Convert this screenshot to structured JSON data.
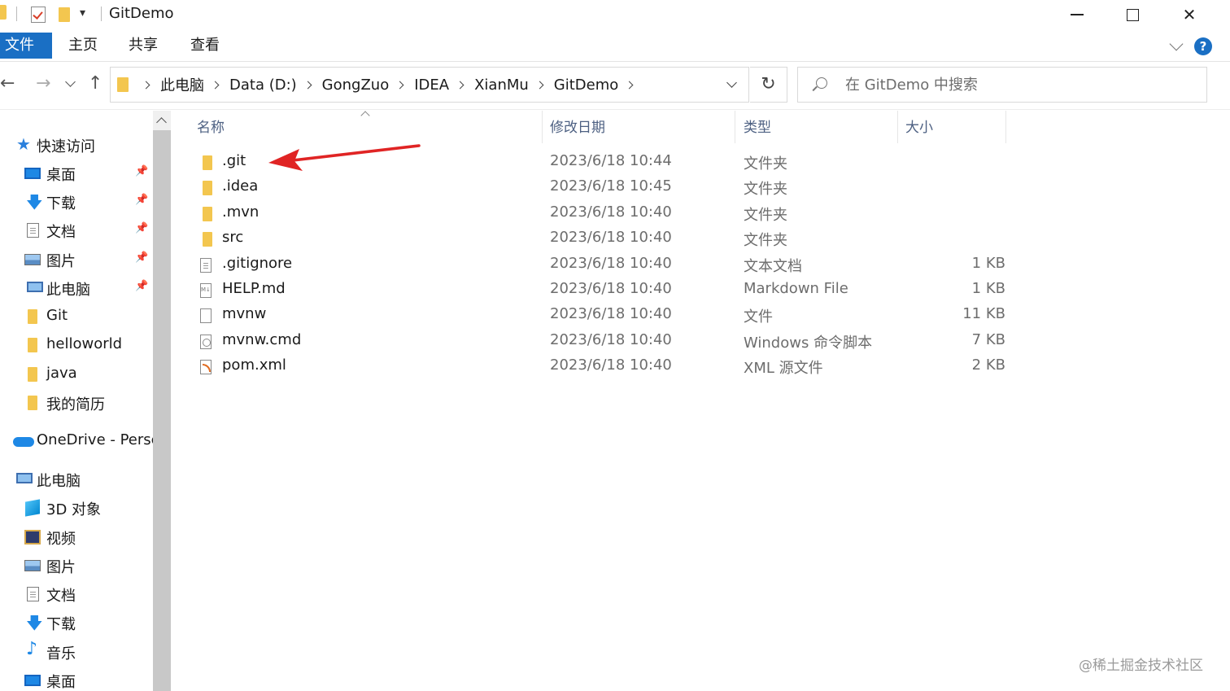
{
  "window": {
    "title": "GitDemo",
    "quick_access_dropdown": "▾",
    "controls": {
      "close_glyph": "✕"
    }
  },
  "ribbon": {
    "tabs": [
      "文件",
      "主页",
      "共享",
      "查看"
    ],
    "help_label": "?"
  },
  "nav": {
    "back_glyph": "←",
    "forward_glyph": "→",
    "up_glyph": "↑",
    "breadcrumbs": [
      "此电脑",
      "Data (D:)",
      "GongZuo",
      "IDEA",
      "XianMu",
      "GitDemo"
    ],
    "refresh_glyph": "↻",
    "search_placeholder": "在 GitDemo 中搜索"
  },
  "sidebar": {
    "quick_access": {
      "label": "快速访问",
      "icon": "star-icon"
    },
    "pinned": [
      {
        "label": "桌面",
        "icon": "desktop-icon"
      },
      {
        "label": "下载",
        "icon": "download-icon"
      },
      {
        "label": "文档",
        "icon": "document-icon"
      },
      {
        "label": "图片",
        "icon": "pictures-icon"
      },
      {
        "label": "此电脑",
        "icon": "computer-icon"
      }
    ],
    "pin_glyph": "📌",
    "recent_folders": [
      "Git",
      "helloworld",
      "java",
      "我的简历"
    ],
    "onedrive": "OneDrive - Persc",
    "this_pc": {
      "label": "此电脑",
      "children": [
        {
          "label": "3D 对象",
          "icon": "3d-objects-icon"
        },
        {
          "label": "视频",
          "icon": "video-icon"
        },
        {
          "label": "图片",
          "icon": "pictures-icon"
        },
        {
          "label": "文档",
          "icon": "document-icon"
        },
        {
          "label": "下载",
          "icon": "download-icon"
        },
        {
          "label": "音乐",
          "icon": "music-icon"
        },
        {
          "label": "桌面",
          "icon": "desktop-icon"
        }
      ]
    }
  },
  "files": {
    "columns": {
      "name": "名称",
      "modified": "修改日期",
      "type": "类型",
      "size": "大小"
    },
    "rows": [
      {
        "name": ".git",
        "modified": "2023/6/18 10:44",
        "type": "文件夹",
        "size": "",
        "icon": "folder-icon"
      },
      {
        "name": ".idea",
        "modified": "2023/6/18 10:45",
        "type": "文件夹",
        "size": "",
        "icon": "folder-icon"
      },
      {
        "name": ".mvn",
        "modified": "2023/6/18 10:40",
        "type": "文件夹",
        "size": "",
        "icon": "folder-icon"
      },
      {
        "name": "src",
        "modified": "2023/6/18 10:40",
        "type": "文件夹",
        "size": "",
        "icon": "folder-icon"
      },
      {
        "name": ".gitignore",
        "modified": "2023/6/18 10:40",
        "type": "文本文档",
        "size": "1 KB",
        "icon": "text-file-icon"
      },
      {
        "name": "HELP.md",
        "modified": "2023/6/18 10:40",
        "type": "Markdown File",
        "size": "1 KB",
        "icon": "markdown-file-icon"
      },
      {
        "name": "mvnw",
        "modified": "2023/6/18 10:40",
        "type": "文件",
        "size": "11 KB",
        "icon": "blank-file-icon"
      },
      {
        "name": "mvnw.cmd",
        "modified": "2023/6/18 10:40",
        "type": "Windows 命令脚本",
        "size": "7 KB",
        "icon": "cmd-file-icon"
      },
      {
        "name": "pom.xml",
        "modified": "2023/6/18 10:40",
        "type": "XML 源文件",
        "size": "2 KB",
        "icon": "xml-file-icon"
      }
    ]
  },
  "annotation": {
    "arrow_color": "#e02424"
  },
  "watermark": "@稀土掘金技术社区",
  "colors": {
    "accent": "#1a6fc4",
    "folder": "#f3c64f",
    "header_text": "#4d6082"
  }
}
